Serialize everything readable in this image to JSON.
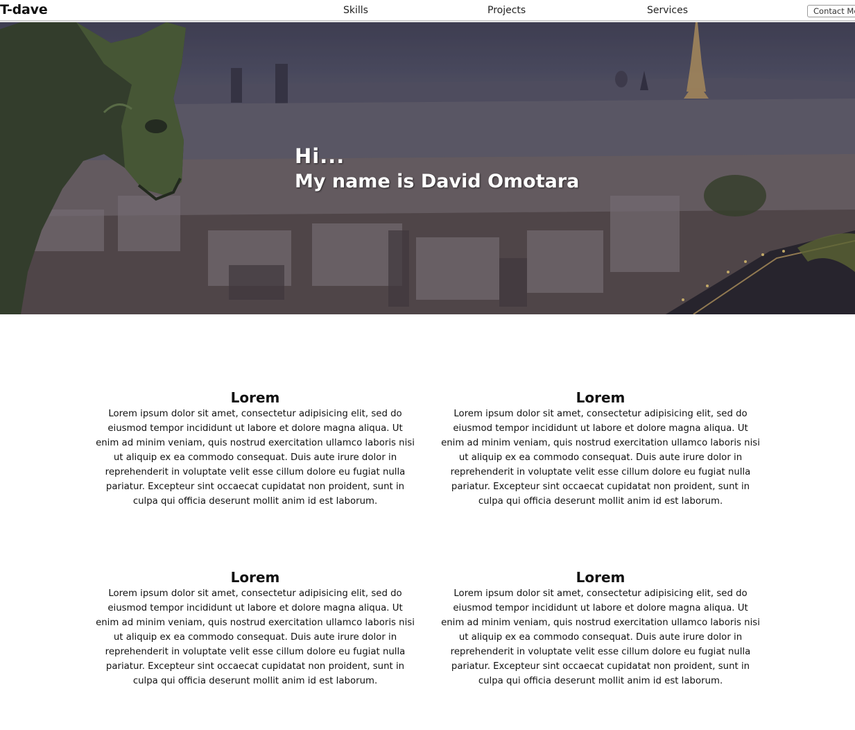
{
  "nav": {
    "brand": "T-dave",
    "links": [
      {
        "label": "Skills"
      },
      {
        "label": "Projects"
      },
      {
        "label": "Services"
      }
    ],
    "contact_label": "Contact Me"
  },
  "hero": {
    "greeting": "Hi...",
    "name_line": "My name is David Omotara",
    "image_description_icon": "paris-gargoyle-skyline-image"
  },
  "cards": [
    {
      "title": "Lorem",
      "body": "Lorem ipsum dolor sit amet, consectetur adipisicing elit, sed do eiusmod tempor incididunt ut labore et dolore magna aliqua. Ut enim ad minim veniam, quis nostrud exercitation ullamco laboris nisi ut aliquip ex ea commodo consequat. Duis aute irure dolor in reprehenderit in voluptate velit esse cillum dolore eu fugiat nulla pariatur. Excepteur sint occaecat cupidatat non proident, sunt in culpa qui officia deserunt mollit anim id est laborum."
    },
    {
      "title": "Lorem",
      "body": "Lorem ipsum dolor sit amet, consectetur adipisicing elit, sed do eiusmod tempor incididunt ut labore et dolore magna aliqua. Ut enim ad minim veniam, quis nostrud exercitation ullamco laboris nisi ut aliquip ex ea commodo consequat. Duis aute irure dolor in reprehenderit in voluptate velit esse cillum dolore eu fugiat nulla pariatur. Excepteur sint occaecat cupidatat non proident, sunt in culpa qui officia deserunt mollit anim id est laborum."
    },
    {
      "title": "Lorem",
      "body": "Lorem ipsum dolor sit amet, consectetur adipisicing elit, sed do eiusmod tempor incididunt ut labore et dolore magna aliqua. Ut enim ad minim veniam, quis nostrud exercitation ullamco laboris nisi ut aliquip ex ea commodo consequat. Duis aute irure dolor in reprehenderit in voluptate velit esse cillum dolore eu fugiat nulla pariatur. Excepteur sint occaecat cupidatat non proident, sunt in culpa qui officia deserunt mollit anim id est laborum."
    },
    {
      "title": "Lorem",
      "body": "Lorem ipsum dolor sit amet, consectetur adipisicing elit, sed do eiusmod tempor incididunt ut labore et dolore magna aliqua. Ut enim ad minim veniam, quis nostrud exercitation ullamco laboris nisi ut aliquip ex ea commodo consequat. Duis aute irure dolor in reprehenderit in voluptate velit esse cillum dolore eu fugiat nulla pariatur. Excepteur sint occaecat cupidatat non proident, sunt in culpa qui officia deserunt mollit anim id est laborum."
    }
  ],
  "colors": {
    "hero_overlay": "#2a2840",
    "text": "#111111",
    "nav_border": "#cfcfcf"
  }
}
